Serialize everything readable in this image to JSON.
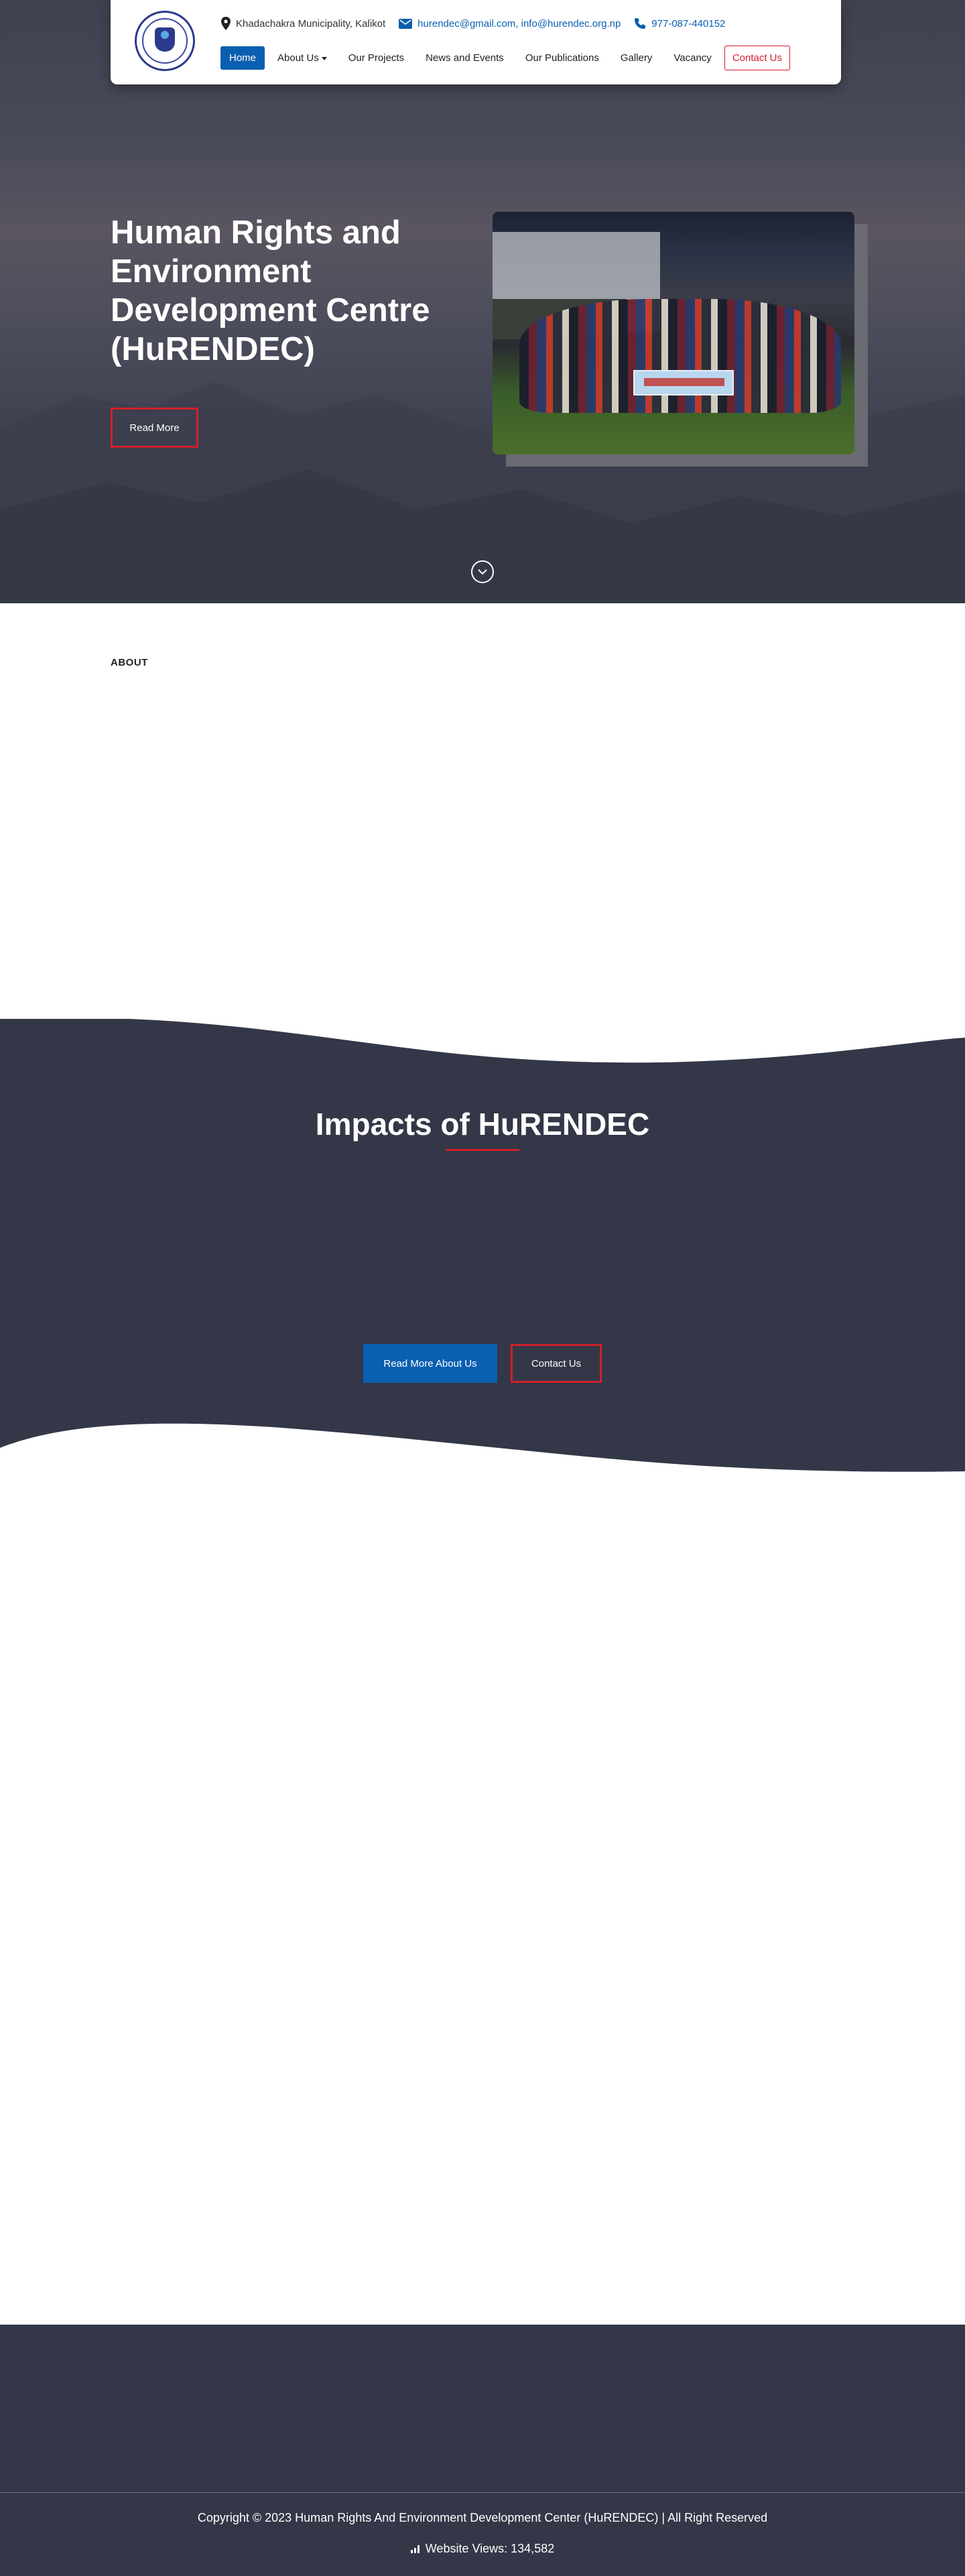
{
  "header": {
    "address": "Khadachakra Municipality, Kalikot",
    "email": "hurendec@gmail.com, info@hurendec.org.np",
    "phone": "977-087-440152",
    "nav": [
      {
        "label": "Home",
        "active": true
      },
      {
        "label": "About Us",
        "dropdown": true
      },
      {
        "label": "Our Projects"
      },
      {
        "label": "News and Events"
      },
      {
        "label": "Our Publications"
      },
      {
        "label": "Gallery"
      },
      {
        "label": "Vacancy"
      }
    ],
    "contact_label": "Contact Us"
  },
  "hero": {
    "title": "Human Rights and Environment Development Centre (HuRENDEC)",
    "read_more": "Read More"
  },
  "about": {
    "label": "ABOUT"
  },
  "impacts": {
    "title": "Impacts of HuRENDEC",
    "read_more_about": "Read More About Us",
    "contact": "Contact Us"
  },
  "footer": {
    "copyright": "Copyright © 2023 Human Rights And Environment Development Center (HuRENDEC) | All Right Reserved",
    "views": "Website Views: 134,582"
  },
  "colors": {
    "primary": "#0b5fb0",
    "accent_red": "#d0202a",
    "dark_section": "#343747"
  },
  "icons": [
    "map-pin-icon",
    "mail-icon",
    "phone-icon",
    "chevron-down-circle-icon",
    "bar-chart-icon"
  ]
}
